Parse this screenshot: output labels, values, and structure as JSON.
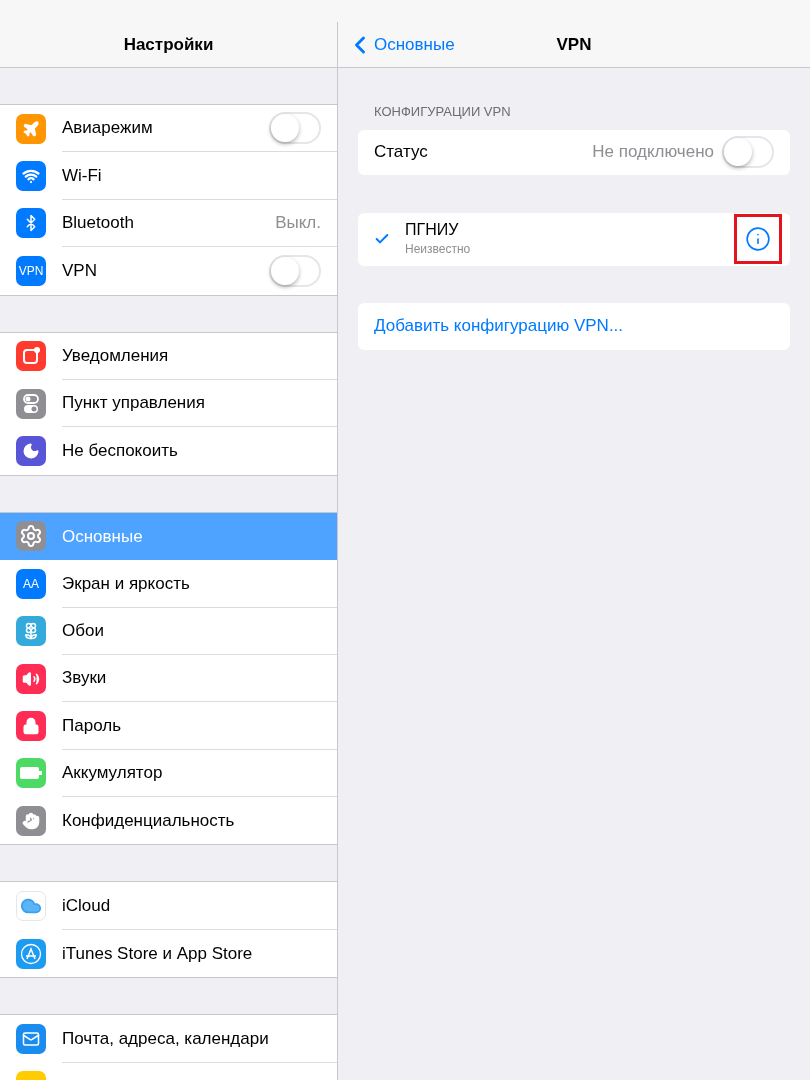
{
  "sidebar": {
    "title": "Настройки",
    "groups": [
      {
        "items": [
          {
            "label": "Авиарежим",
            "kind": "toggle",
            "on": false,
            "color": "#ff9500",
            "selected": false
          },
          {
            "label": "Wi-Fi",
            "kind": "plain",
            "color": "#007aff",
            "selected": false
          },
          {
            "label": "Bluetooth",
            "kind": "value",
            "value": "Выкл.",
            "color": "#007aff",
            "selected": false
          },
          {
            "label": "VPN",
            "kind": "toggle",
            "on": false,
            "color": "#007aff",
            "icon_text": "VPN",
            "selected": false
          }
        ]
      },
      {
        "items": [
          {
            "label": "Уведомления",
            "kind": "plain",
            "color": "#ff3b30",
            "selected": false
          },
          {
            "label": "Пункт управления",
            "kind": "plain",
            "color": "#8e8e93",
            "selected": false
          },
          {
            "label": "Не беспокоить",
            "kind": "plain",
            "color": "#5856d6",
            "selected": false
          }
        ]
      },
      {
        "items": [
          {
            "label": "Основные",
            "kind": "plain",
            "color": "#8e8e93",
            "selected": true
          },
          {
            "label": "Экран и яркость",
            "kind": "plain",
            "color": "#007aff",
            "icon_text": "AA",
            "selected": false
          },
          {
            "label": "Обои",
            "kind": "plain",
            "color": "#34aadc",
            "selected": false
          },
          {
            "label": "Звуки",
            "kind": "plain",
            "color": "#ff2d55",
            "selected": false
          },
          {
            "label": "Пароль",
            "kind": "plain",
            "color": "#ff2d55",
            "selected": false
          },
          {
            "label": "Аккумулятор",
            "kind": "plain",
            "color": "#4cd964",
            "selected": false
          },
          {
            "label": "Конфиденциальность",
            "kind": "plain",
            "color": "#8e8e93",
            "selected": false
          }
        ]
      },
      {
        "items": [
          {
            "label": "iCloud",
            "kind": "plain",
            "color": "#ffffff",
            "selected": false
          },
          {
            "label": "iTunes Store и App Store",
            "kind": "plain",
            "color": "#1d9bf0",
            "selected": false
          }
        ]
      },
      {
        "items": [
          {
            "label": "Почта, адреса, календари",
            "kind": "plain",
            "color": "#1a8cf0",
            "selected": false
          },
          {
            "kind": "plain",
            "color": "#ffcc00",
            "selected": false
          }
        ]
      }
    ]
  },
  "detail": {
    "back": "Основные",
    "title": "VPN",
    "section_header": "КОНФИГУРАЦИИ VPN",
    "status": {
      "label": "Статус",
      "value": "Не подключено",
      "on": false
    },
    "configs": [
      {
        "name": "ПГНИУ",
        "subtitle": "Неизвестно",
        "checked": true,
        "highlighted": true
      }
    ],
    "add": "Добавить конфигурацию VPN..."
  }
}
